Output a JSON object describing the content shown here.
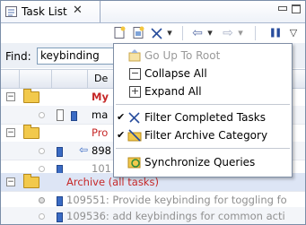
{
  "view": {
    "title": "Task List",
    "close": "✕"
  },
  "toolbar": {
    "icons": [
      "new-task-icon",
      "new-category-icon",
      "filter-icon",
      "dropdown-icon",
      "back-icon",
      "forward-icon",
      "pause-icon",
      "view-menu-icon"
    ],
    "glyphs": {
      "back": "⇦",
      "forward": "⇨",
      "dropdown": "▾",
      "pause": "❚❚",
      "menu": "▽"
    }
  },
  "find": {
    "label": "Find:",
    "value": "keybinding"
  },
  "table": {
    "header_label": "De",
    "rows": [
      {
        "text": "My",
        "style": "red",
        "toggle": "−"
      },
      {
        "text": "ma",
        "style": "normal"
      },
      {
        "text": "Pro",
        "style": "redn"
      },
      {
        "text": "898",
        "style": "normal"
      },
      {
        "text": "101",
        "style": "grey"
      },
      {
        "text": "Archive (all tasks)",
        "style": "redn",
        "toggle": "−"
      },
      {
        "text": "109551: Provide keybinding for toggling fo",
        "style": "grey"
      },
      {
        "text": "109536: add keybindings for common acti",
        "style": "grey"
      }
    ]
  },
  "menu": {
    "items": [
      {
        "label": "Go Up To Root",
        "disabled": true,
        "icon": "go-up-icon",
        "checked": false
      },
      {
        "label": "Collapse All",
        "disabled": false,
        "icon": "collapse-all-icon",
        "checked": false
      },
      {
        "label": "Expand All",
        "disabled": false,
        "icon": "expand-all-icon",
        "checked": false
      },
      {
        "label": "Filter Completed Tasks",
        "disabled": false,
        "icon": "filter-completed-icon",
        "checked": true
      },
      {
        "label": "Filter Archive Category",
        "disabled": false,
        "icon": "filter-archive-icon",
        "checked": true
      },
      {
        "label": "Synchronize Queries",
        "disabled": false,
        "icon": "synchronize-icon",
        "checked": false
      }
    ],
    "check_glyph": "✔"
  }
}
